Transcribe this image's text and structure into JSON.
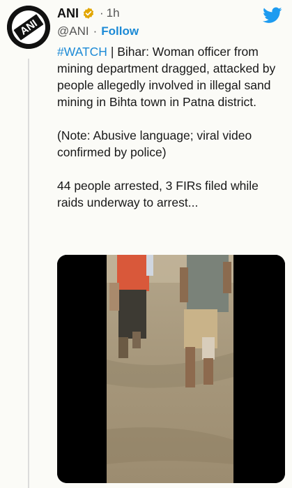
{
  "tweet": {
    "author_name": "ANI",
    "handle": "@ANI",
    "time": "1h",
    "follow_label": "Follow",
    "hashtag": "#WATCH",
    "text_part1": " | Bihar: Woman officer from mining department dragged, attacked by people allegedly involved in illegal sand mining in Bihta town in Patna district.",
    "note": "(Note: Abusive language; viral video confirmed by police)",
    "summary": "44 people arrested, 3 FIRs filed while raids underway to arrest...",
    "avatar_text": "ANI"
  },
  "icons": {
    "verified": "verified-badge-icon",
    "twitter": "twitter-bird-icon"
  },
  "colors": {
    "link_blue": "#1c8ad6",
    "verified_gold": "#e2a600",
    "twitter_blue": "#1d9bf0"
  }
}
